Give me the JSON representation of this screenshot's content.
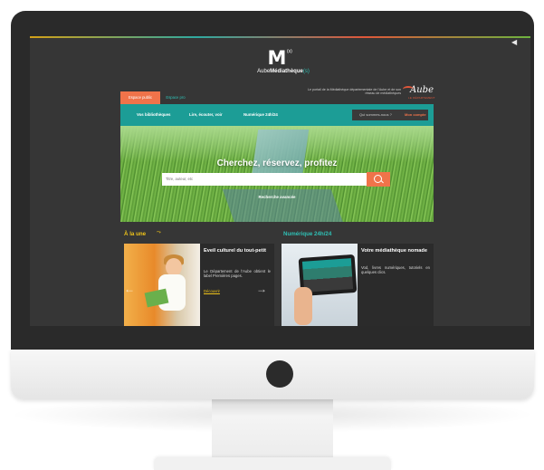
{
  "site": {
    "logo_mark": "M",
    "logo_sup": "(s)",
    "logo_name_prefix": "Aube",
    "logo_name_main": "Médiathèque",
    "logo_name_suffix": "(s)",
    "tagline": "Le portail de la Médiathèque départementale de l'Aube et de son réseau de médiathèques",
    "partner_logo_word": "Aube",
    "partner_logo_sub": "LE DÉPARTEMENT"
  },
  "tabs": {
    "public": "Espace public",
    "pro": "Espace pro"
  },
  "nav": {
    "items": [
      "Vos bibliothèques",
      "Lire, écouter, voir",
      "Numérique 24h/24"
    ],
    "help": "Qui sommes-nous ?",
    "account": "Mon compte"
  },
  "hero": {
    "title": "Cherchez, réservez, profitez",
    "search_placeholder": "Titre, auteur, etc",
    "advanced": "Recherche avancée"
  },
  "sections": {
    "left_title": "À la une",
    "right_title": "Numérique 24h/24"
  },
  "cards": [
    {
      "heading": "Eveil culturel du tout-petit",
      "text": "Le Département de l'Aube obtient le label Premières pages.",
      "link": "Découvrir"
    },
    {
      "heading": "Votre médiathèque nomade",
      "text": "Vod, livres numériques, tutoriels en quelques clics."
    }
  ],
  "colors": {
    "teal": "#1c9d96",
    "orange": "#f0734a",
    "yellow": "#f0c419",
    "screen_bg": "#363636"
  }
}
